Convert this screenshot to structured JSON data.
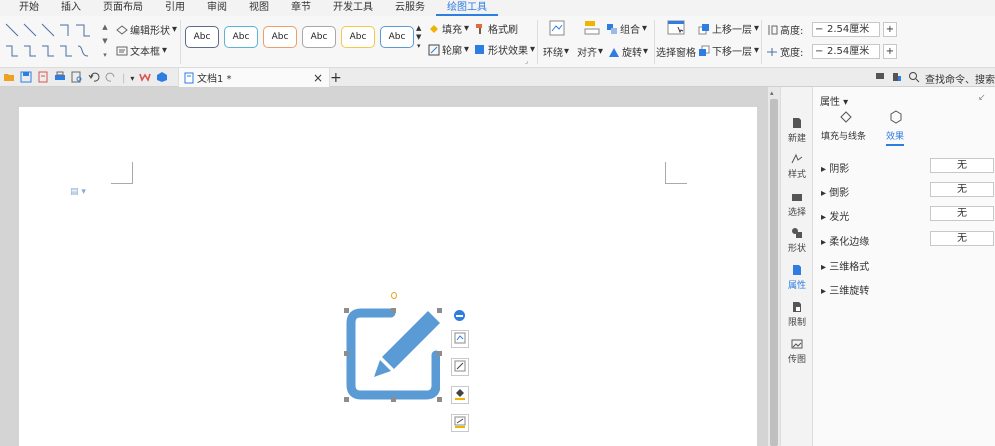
{
  "menu": {
    "tabs": [
      "开始",
      "插入",
      "页面布局",
      "引用",
      "审阅",
      "视图",
      "章节",
      "开发工具",
      "云服务",
      "绘图工具"
    ],
    "active_tab": "绘图工具"
  },
  "ribbon": {
    "edit_shape": "编辑形状",
    "textbox": "文本框",
    "style_label": "Abc",
    "fill": "填充",
    "format_brush": "格式刷",
    "outline": "轮廓",
    "shape_effects": "形状效果",
    "wrap": "环绕",
    "align": "对齐",
    "rotate": "旋转",
    "selection_pane": "选择窗格",
    "group": "组合",
    "bring_forward": "上移一层",
    "send_backward": "下移一层",
    "height_label": "高度:",
    "height_value": "2.54厘米",
    "width_label": "宽度:",
    "width_value": "2.54厘米",
    "minus": "−",
    "plus": "+"
  },
  "qbar": {
    "doc_title": "文档1 *",
    "close": "×",
    "new_tab": "+",
    "search": "查找命令、搜索"
  },
  "sidebar": {
    "items": [
      "新建",
      "样式",
      "选择",
      "形状",
      "属性",
      "限制",
      "传图"
    ],
    "active": "属性"
  },
  "props": {
    "title": "属性",
    "tab_fill": "填充与线条",
    "tab_effect": "效果",
    "rows": [
      {
        "label": "阴影",
        "value": "无"
      },
      {
        "label": "倒影",
        "value": "无"
      },
      {
        "label": "发光",
        "value": "无"
      },
      {
        "label": "柔化边缘",
        "value": "无"
      },
      {
        "label": "三维格式",
        "value": ""
      },
      {
        "label": "三维旋转",
        "value": ""
      }
    ]
  },
  "colors": {
    "accent": "#2e7de1",
    "shape_blue": "#5b9bd5"
  }
}
